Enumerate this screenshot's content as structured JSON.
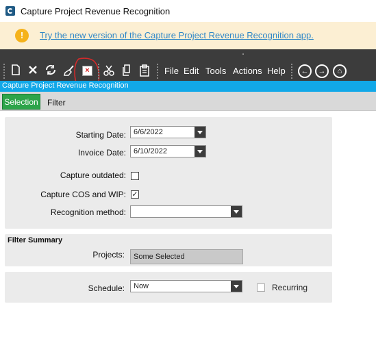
{
  "window": {
    "title": "Capture Project Revenue Recognition"
  },
  "banner": {
    "icon": "!",
    "link_text": "Try the new version of the Capture Project Revenue Recognition app."
  },
  "toolbar": {
    "icons": {
      "new": "new-document-icon",
      "delete": "delete-icon",
      "refresh": "refresh-icon",
      "clear": "broom-icon",
      "close": "close-form-icon",
      "cut": "scissors-icon",
      "copy": "copy-icon",
      "paste": "paste-icon"
    },
    "close_glyph": "×",
    "menus": [
      "File",
      "Edit",
      "Tools",
      "Actions",
      "Help"
    ],
    "nav": {
      "back": "←",
      "forward": "→",
      "home": "⌂"
    }
  },
  "form_strip": {
    "title": "Capture Project Revenue Recognition"
  },
  "tabs": [
    {
      "label": "Selection",
      "active": true
    },
    {
      "label": "Filter",
      "active": false
    }
  ],
  "selection": {
    "starting_date": {
      "label": "Starting Date:",
      "value": "6/6/2022"
    },
    "invoice_date": {
      "label": "Invoice Date:",
      "value": "6/10/2022"
    },
    "capture_outdated": {
      "label": "Capture outdated:",
      "checked": false,
      "mark": ""
    },
    "capture_cos_wip": {
      "label": "Capture COS and WIP:",
      "checked": true,
      "mark": "✓"
    },
    "recognition_method": {
      "label": "Recognition method:",
      "value": ""
    }
  },
  "filter_summary": {
    "title": "Filter Summary",
    "projects": {
      "label": "Projects:",
      "value": "Some Selected"
    }
  },
  "schedule": {
    "label": "Schedule:",
    "value": "Now",
    "recurring": {
      "label": "Recurring",
      "checked": false
    }
  },
  "colors": {
    "toolbar_bg": "#3c3c3c",
    "accent_blue": "#11a8e8",
    "tab_green": "#2da44a",
    "annotation_red": "#d42a2a"
  }
}
